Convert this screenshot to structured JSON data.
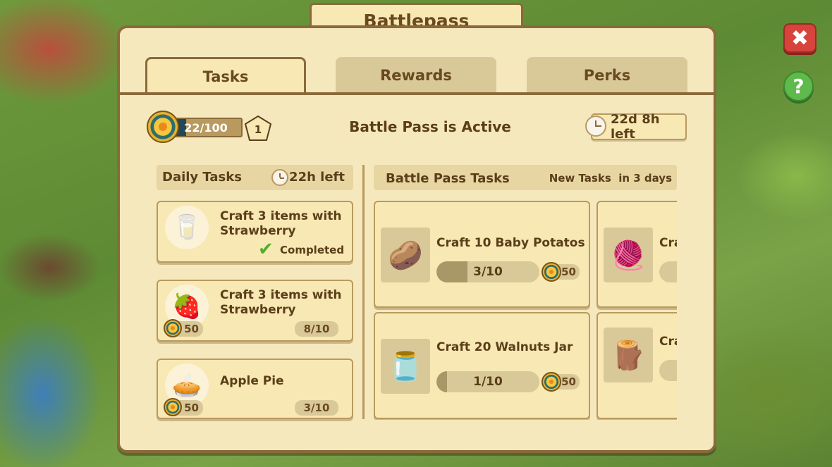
{
  "title": "Battlepass",
  "tabs": [
    {
      "label": "Tasks",
      "active": true
    },
    {
      "label": "Rewards",
      "active": false
    },
    {
      "label": "Perks",
      "active": false
    }
  ],
  "status": {
    "progress_text": "22/100",
    "progress_value": 22,
    "progress_max": 100,
    "level": "1",
    "active_text": "Battle Pass is Active",
    "time_left": "22d 8h left"
  },
  "daily": {
    "header": "Daily Tasks",
    "time_left": "22h left",
    "tasks": [
      {
        "icon": "milk-bottle-icon",
        "title_line1": "Craft 3 items with",
        "title_line2": "Strawberry",
        "completed_label": "Completed"
      },
      {
        "icon": "strawberry-icon",
        "title_line1": "Craft 3 items with",
        "title_line2": "Strawberry",
        "reward": "50",
        "progress": "8/10"
      },
      {
        "icon": "apple-pie-icon",
        "title_line1": "Apple Pie",
        "reward": "50",
        "progress": "3/10"
      }
    ]
  },
  "battle_tasks": {
    "header": "Battle Pass Tasks",
    "new_tasks": "New Tasks  in 3 days",
    "cards": [
      {
        "icon": "baby-potatoes-icon",
        "title": "Craft 10 Baby Potatos",
        "progress": "3/10",
        "fraction": 0.3,
        "reward": "50"
      },
      {
        "icon": "walnuts-jar-icon",
        "title": "Craft 20 Walnuts Jar",
        "progress": "1/10",
        "fraction": 0.1,
        "reward": "50"
      },
      {
        "icon": "yarn-icon",
        "title": "Cra"
      },
      {
        "icon": "cinnamon-sticks-icon",
        "title": "Cra"
      }
    ]
  },
  "colors": {
    "frame": "#8a6a3a",
    "panel": "#f6e8bd",
    "close": "#d7443c",
    "help": "#5fb94b"
  }
}
